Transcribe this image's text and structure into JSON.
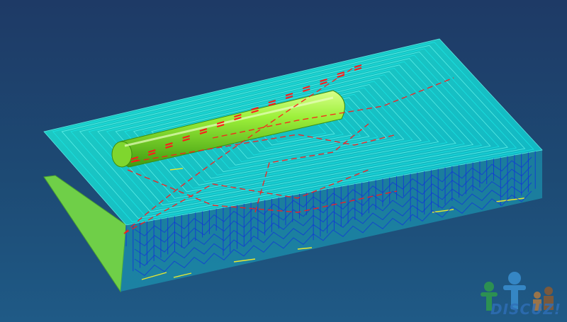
{
  "viewport": {
    "background_top": "#1e3a66",
    "background_bottom": "#1f5a86"
  },
  "colors": {
    "stock_top": "#0fd6d2",
    "toolpath_cyan": "#19e6e6",
    "toolpath_blue": "#1136d8",
    "toolpath_yellow": "#e8e832",
    "rapid_red": "#ff1a1a",
    "cylinder_green": "#8be832",
    "stock_side": "#7fd64a"
  },
  "watermark": {
    "text": "DISCUZ!"
  }
}
